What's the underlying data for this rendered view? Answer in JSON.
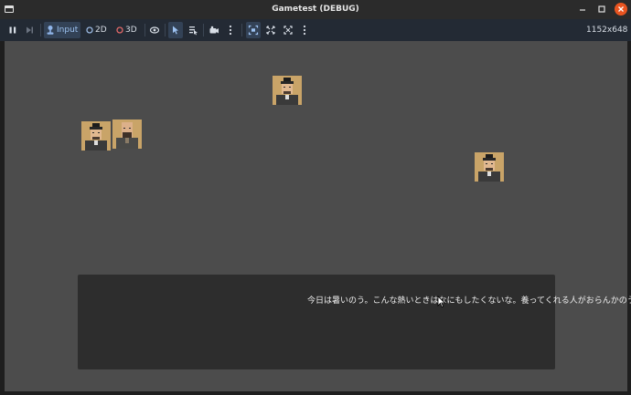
{
  "window": {
    "title": "Gametest (DEBUG)",
    "controls": [
      "minimize-icon",
      "maximize-icon",
      "close-icon"
    ]
  },
  "toolbar": {
    "pause_icon": "pause-icon",
    "step_icon": "step-forward-icon",
    "input_label": "Input",
    "mode_2d_label": "2D",
    "mode_3d_label": "3D",
    "resolution": "1152x648"
  },
  "viewport": {
    "dialog_text": "今日は暑いのう。こんな熱いときはなにもしたくないな。養ってくれる人がおらんかのう。"
  },
  "colors": {
    "titlebar": "#2b2b2b",
    "toolbar": "#232a34",
    "viewport": "#4c4c4c",
    "dialog": "#2d2d2d",
    "close_button": "#e95420",
    "mode_3d_accent": "#e06868",
    "mode_2d_accent": "#9ab8e0"
  }
}
